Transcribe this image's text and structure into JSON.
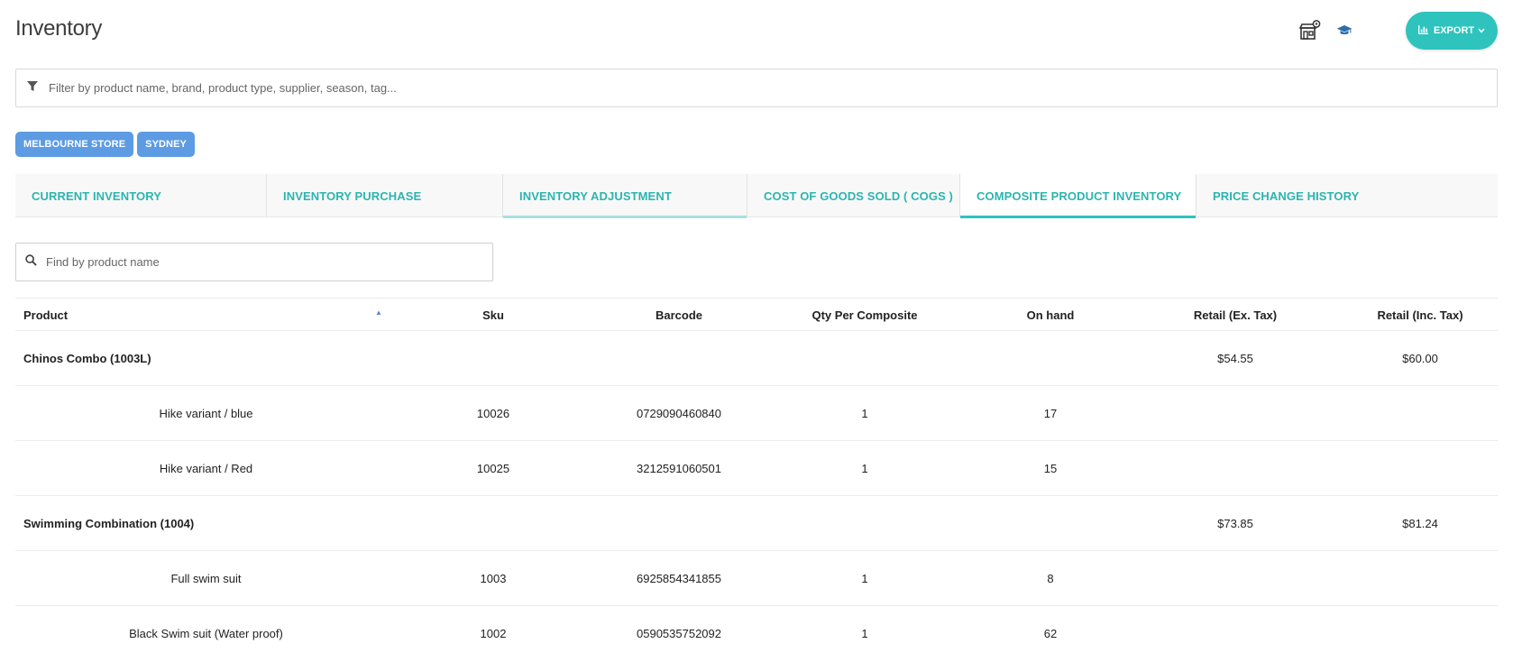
{
  "header": {
    "title": "Inventory",
    "export_label": "EXPORT",
    "icons": [
      "store-location-icon",
      "graduation-cap-icon",
      "bar-chart-icon",
      "chevron-down-icon"
    ],
    "accent_color": "#2ec3bd"
  },
  "filter": {
    "placeholder": "Filter by product name, brand, product type, supplier, season, tag..."
  },
  "stores": [
    "MELBOURNE STORE",
    "SYDNEY"
  ],
  "tabs": [
    {
      "label": "CURRENT INVENTORY"
    },
    {
      "label": "INVENTORY PURCHASE"
    },
    {
      "label": "INVENTORY ADJUSTMENT"
    },
    {
      "label": "COST OF GOODS SOLD ( COGS )"
    },
    {
      "label": "COMPOSITE PRODUCT INVENTORY"
    },
    {
      "label": "PRICE CHANGE HISTORY"
    }
  ],
  "active_tab": "COMPOSITE PRODUCT INVENTORY",
  "search": {
    "placeholder": "Find by product name"
  },
  "table": {
    "columns": [
      "Product",
      "Sku",
      "Barcode",
      "Qty Per Composite",
      "On hand",
      "Retail (Ex. Tax)",
      "Retail (Inc. Tax)"
    ],
    "rows": [
      {
        "product": "Chinos Combo (1003L)",
        "sku": "",
        "barcode": "",
        "qty": "",
        "on_hand": "",
        "retail_ex": "$54.55",
        "retail_inc": "$60.00"
      },
      {
        "product": "Hike variant / blue",
        "sku": "10026",
        "barcode": "0729090460840",
        "qty": "1",
        "on_hand": "17",
        "retail_ex": "",
        "retail_inc": ""
      },
      {
        "product": "Hike variant / Red",
        "sku": "10025",
        "barcode": "3212591060501",
        "qty": "1",
        "on_hand": "15",
        "retail_ex": "",
        "retail_inc": ""
      },
      {
        "product": "Swimming Combination (1004)",
        "sku": "",
        "barcode": "",
        "qty": "",
        "on_hand": "",
        "retail_ex": "$73.85",
        "retail_inc": "$81.24"
      },
      {
        "product": "Full swim suit",
        "sku": "1003",
        "barcode": "6925854341855",
        "qty": "1",
        "on_hand": "8",
        "retail_ex": "",
        "retail_inc": ""
      },
      {
        "product": "Black Swim suit (Water proof)",
        "sku": "1002",
        "barcode": "0590535752092",
        "qty": "1",
        "on_hand": "62",
        "retail_ex": "",
        "retail_inc": ""
      }
    ]
  }
}
